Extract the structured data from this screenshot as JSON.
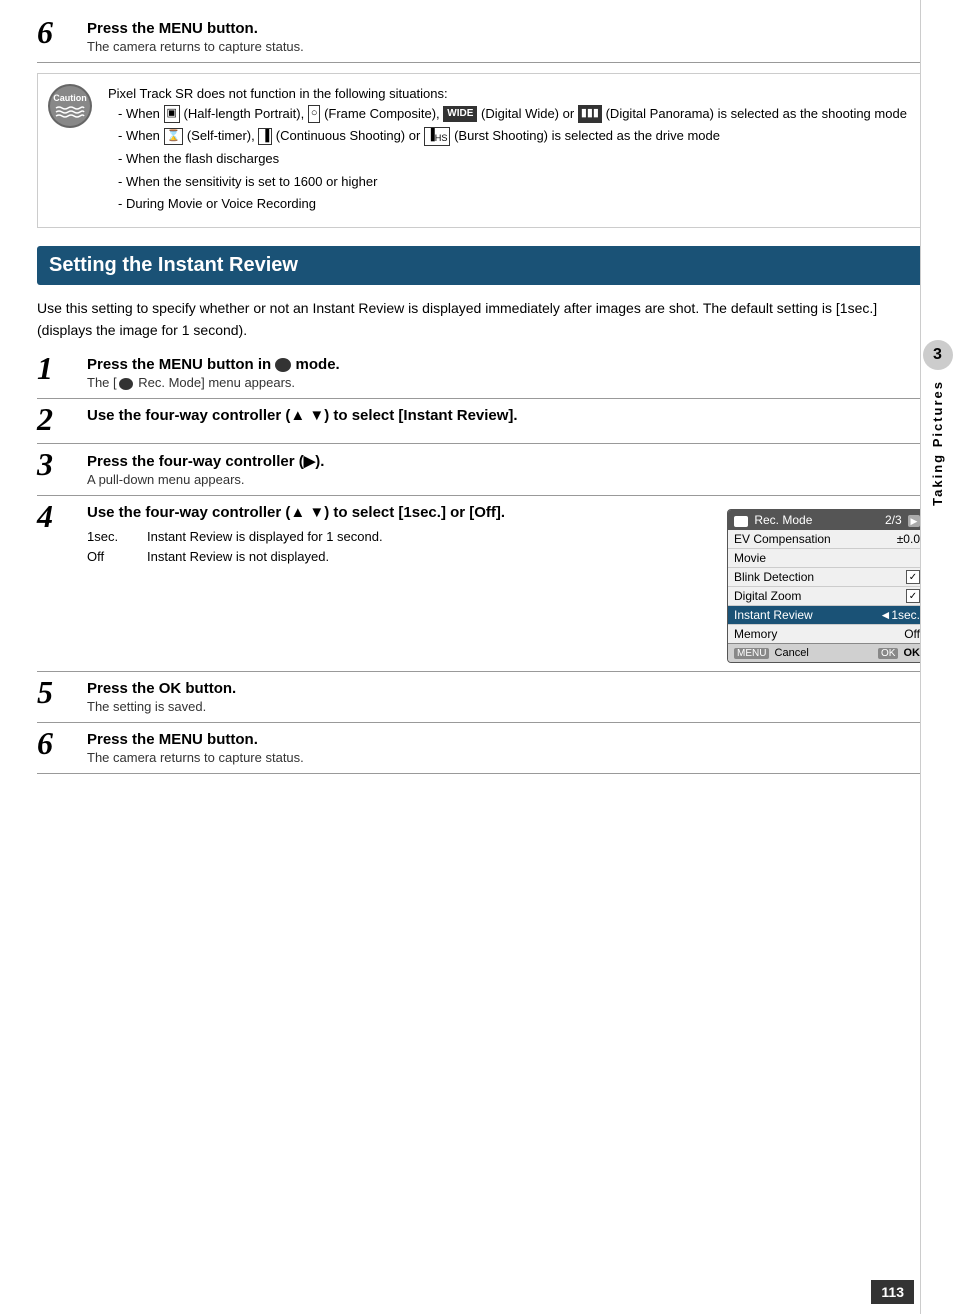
{
  "page": {
    "number": "113",
    "side_tab_number": "3",
    "side_tab_text": "Taking Pictures"
  },
  "top_section": {
    "step6_number": "6",
    "step6_title_pre": "Press the ",
    "step6_title_menu": "MENU",
    "step6_title_post": " button.",
    "step6_subtitle": "The camera returns to capture status.",
    "caution_label": "Caution",
    "caution_intro": "Pixel Track SR does not function in the following situations:",
    "caution_items": [
      "When  (Half-length Portrait),  (Frame Composite),  (Digital Wide) or  (Digital Panorama) is selected as the shooting mode",
      "When  (Self-timer),  (Continuous Shooting) or  (Burst Shooting) is selected as the drive mode",
      "When the flash discharges",
      "When the sensitivity is set to 1600 or higher",
      "During Movie or Voice Recording"
    ]
  },
  "section": {
    "title": "Setting the Instant Review",
    "intro": "Use this setting to specify whether or not an Instant Review is displayed immediately after images are shot. The default setting is [1sec.] (displays the image for 1 second)."
  },
  "steps": [
    {
      "number": "1",
      "title_pre": "Press the ",
      "title_menu": "MENU",
      "title_post": " button in  mode.",
      "subtitle": "The [ Rec. Mode] menu appears."
    },
    {
      "number": "2",
      "title": "Use the four-way controller (▲ ▼) to select [Instant Review].",
      "subtitle": ""
    },
    {
      "number": "3",
      "title_pre": "Press the four-way controller (▶).",
      "subtitle": "A pull-down menu appears."
    },
    {
      "number": "4",
      "title": "Use the four-way controller (▲ ▼) to select [1sec.] or [Off].",
      "options": [
        {
          "key": "1sec.",
          "desc": "Instant Review is displayed for 1 second."
        },
        {
          "key": "Off",
          "desc": "Instant Review is not displayed."
        }
      ]
    },
    {
      "number": "5",
      "title_pre": "Press the ",
      "title_ok": "OK",
      "title_post": " button.",
      "subtitle": "The setting is saved."
    },
    {
      "number": "6",
      "title_pre": "Press the ",
      "title_menu": "MENU",
      "title_post": " button.",
      "subtitle": "The camera returns to capture status."
    }
  ],
  "menu_table": {
    "header_icon": "camera",
    "header_title": "Rec. Mode",
    "header_page": "2/3",
    "rows": [
      {
        "label": "EV Compensation",
        "value": "±0.0",
        "type": "text"
      },
      {
        "label": "Movie",
        "value": "",
        "type": "text"
      },
      {
        "label": "Blink Detection",
        "value": "checked",
        "type": "check"
      },
      {
        "label": "Digital Zoom",
        "value": "checked",
        "type": "check"
      },
      {
        "label": "Instant Review",
        "value": "◄1sec.",
        "type": "highlight"
      },
      {
        "label": "Memory",
        "value": "Off",
        "type": "text"
      }
    ],
    "footer_cancel": "Cancel",
    "footer_cancel_btn": "MENU",
    "footer_ok": "OK",
    "footer_ok_btn": "OK"
  }
}
